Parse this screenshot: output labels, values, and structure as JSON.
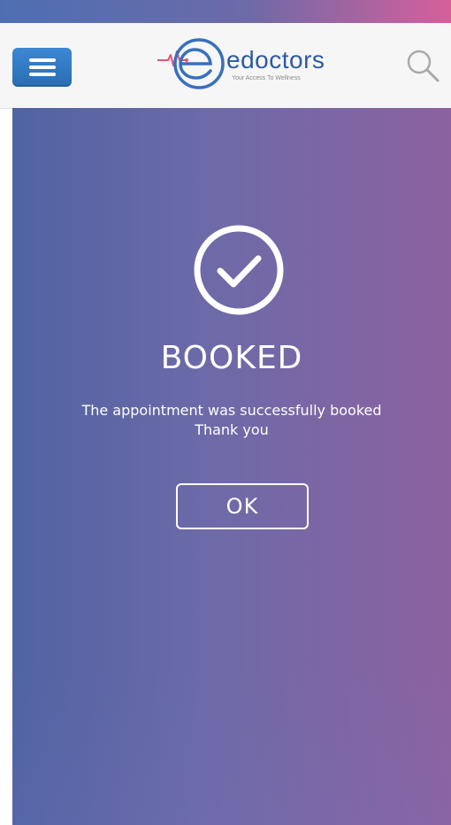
{
  "app": {
    "logo": {
      "brand_text": "edoctors",
      "tagline": "Your Access To Wellness"
    }
  },
  "header": {
    "menu_icon": "menu-icon",
    "search_icon": "search-icon"
  },
  "confirmation": {
    "status_icon": "check-circle-icon",
    "title": "BOOKED",
    "message_line_1": "The appointment was successfully booked",
    "message_line_2": "Thank you",
    "ok_label": "OK"
  },
  "colors": {
    "primary_blue": "#2d5aa5",
    "header_button_blue": "#3d87d4",
    "gradient_left": "#5063a3",
    "gradient_right": "#8c62a0",
    "accent_pink": "#d65f9a",
    "white": "#ffffff"
  }
}
